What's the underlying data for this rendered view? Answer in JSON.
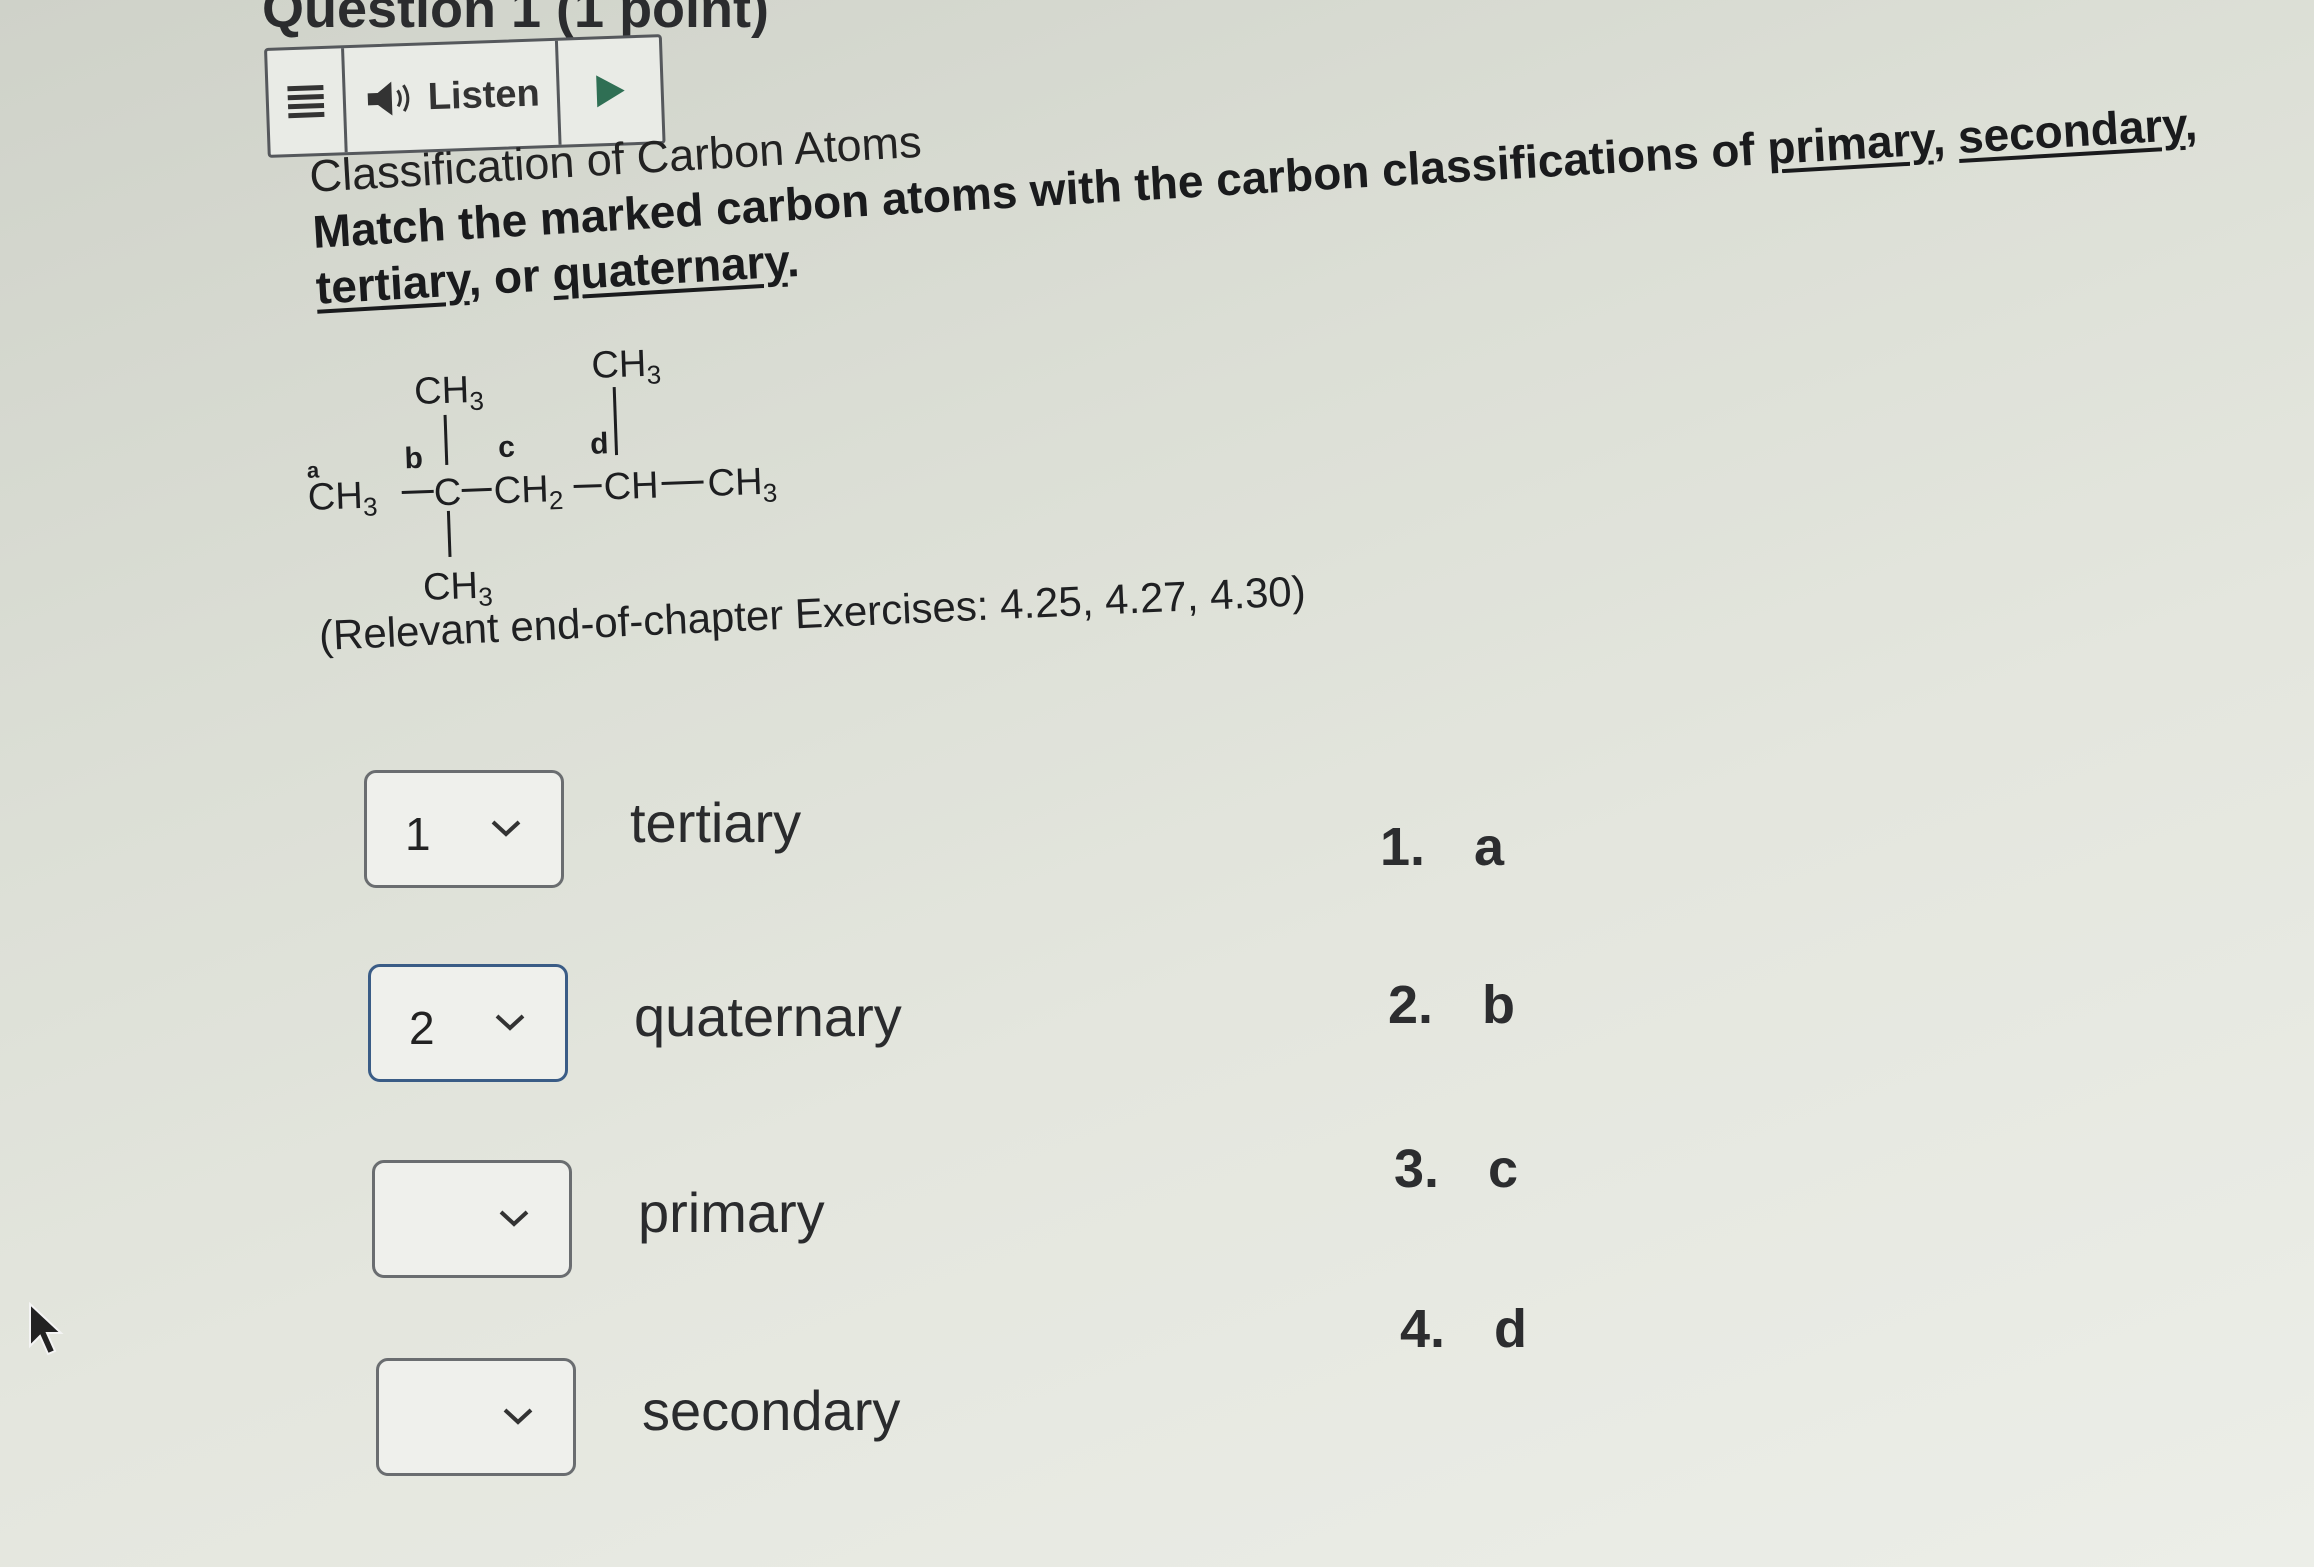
{
  "question": {
    "heading": "Question 1 (1 point)"
  },
  "listen_toolbar": {
    "listen_label": "Listen"
  },
  "prompt": {
    "title": "Classification of Carbon Atoms",
    "instruction_start": "Match the marked carbon atoms with the carbon classifications of",
    "primary": "primary",
    "secondary": "secondary",
    "tertiary": "tertiary",
    "or": "or",
    "quaternary": "quaternary",
    "comma": ",",
    "period": "."
  },
  "structure": {
    "ch3": "CH",
    "ch2": "CH",
    "ch": "CH",
    "c": "C",
    "sub3": "3",
    "sub2": "2",
    "label_a": "a",
    "label_b": "b",
    "label_c": "c",
    "label_d": "d"
  },
  "exercises": "(Relevant end-of-chapter Exercises: 4.25, 4.27, 4.30)",
  "matches": [
    {
      "selected": "1",
      "term": "tertiary"
    },
    {
      "selected": "2",
      "term": "quaternary"
    },
    {
      "selected": "",
      "term": "primary"
    },
    {
      "selected": "",
      "term": "secondary"
    }
  ],
  "answers": [
    {
      "num": "1.",
      "label": "a"
    },
    {
      "num": "2.",
      "label": "b"
    },
    {
      "num": "3.",
      "label": "c"
    },
    {
      "num": "4.",
      "label": "d"
    }
  ],
  "colors": {
    "active_border": "#3a5c86",
    "page_bg": "#e4e6de"
  },
  "icons": [
    "menu-icon",
    "speaker-icon",
    "play-icon",
    "chevron-down-icon",
    "mouse-cursor-icon"
  ]
}
